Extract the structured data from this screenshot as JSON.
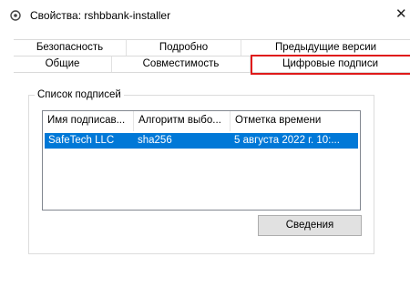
{
  "window": {
    "title": "Свойства: rshbbank-installer",
    "close_glyph": "✕"
  },
  "tabs": {
    "row1": [
      {
        "label": "Безопасность"
      },
      {
        "label": "Подробно"
      },
      {
        "label": "Предыдущие версии"
      }
    ],
    "row2": [
      {
        "label": "Общие"
      },
      {
        "label": "Совместимость"
      },
      {
        "label": "Цифровые подписи",
        "active": true
      }
    ]
  },
  "signatures": {
    "group_label": "Список подписей",
    "columns": [
      "Имя подписав...",
      "Алгоритм выбо...",
      "Отметка времени"
    ],
    "rows": [
      {
        "name": "SafeTech LLC",
        "algorithm": "sha256",
        "timestamp": "5 августа 2022 г. 10:...",
        "selected": true
      }
    ],
    "details_button": "Сведения"
  },
  "colors": {
    "selection": "#0078d7",
    "highlight_box": "#e01a1a"
  },
  "icons": {
    "title": "properties-icon"
  }
}
